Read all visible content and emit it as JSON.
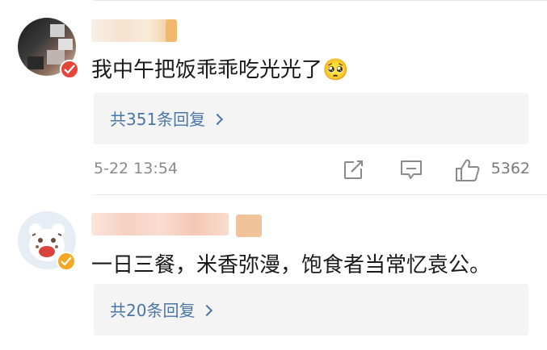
{
  "comments": [
    {
      "text": "我中午把饭乖乖吃光光了🥺",
      "replies_label": "共351条回复",
      "timestamp": "5-22 13:54",
      "like_count": "5362"
    },
    {
      "text": "一日三餐，米香弥漫，饱食者当常忆袁公。",
      "replies_label": "共20条回复"
    }
  ],
  "colors": {
    "link": "#4a76a8",
    "reply_box_bg": "#f4f4f4",
    "text": "#1a1a1a",
    "meta": "#8a8a8a"
  },
  "icons": [
    "share-icon",
    "comment-icon",
    "like-icon",
    "chevron-right-icon",
    "verified-badge-icon"
  ]
}
